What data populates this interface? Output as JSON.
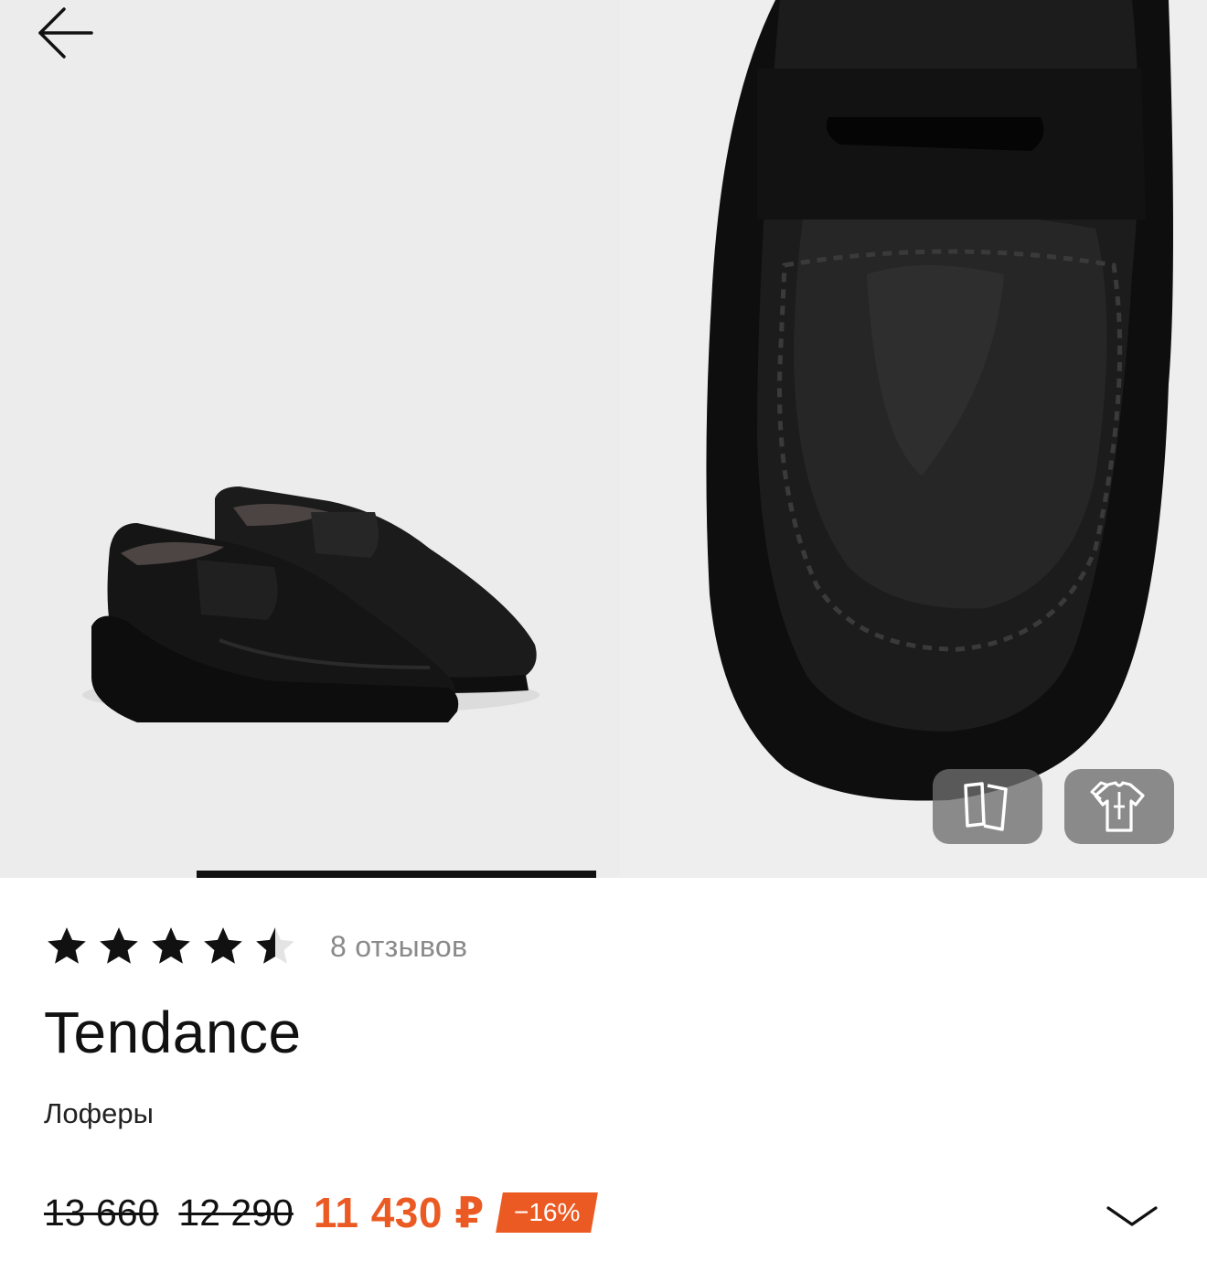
{
  "rating": {
    "value": 4.5,
    "max": 5,
    "reviews_label": "8 отзывов"
  },
  "product": {
    "brand": "Tendance",
    "category": "Лоферы"
  },
  "pricing": {
    "old_prices": [
      "13 660",
      "12 290"
    ],
    "current_price": "11 430 ₽",
    "discount": "−16%"
  },
  "gallery": {
    "active_indicator": 1,
    "indicator_count": 3
  },
  "icons": {
    "back": "arrow-left-icon",
    "compare": "compare-cards-icon",
    "fitting": "tshirt-fitting-icon",
    "expand": "chevron-down-icon"
  },
  "colors": {
    "accent": "#ec5a24",
    "text": "#111111",
    "muted": "#8a8a8a"
  }
}
